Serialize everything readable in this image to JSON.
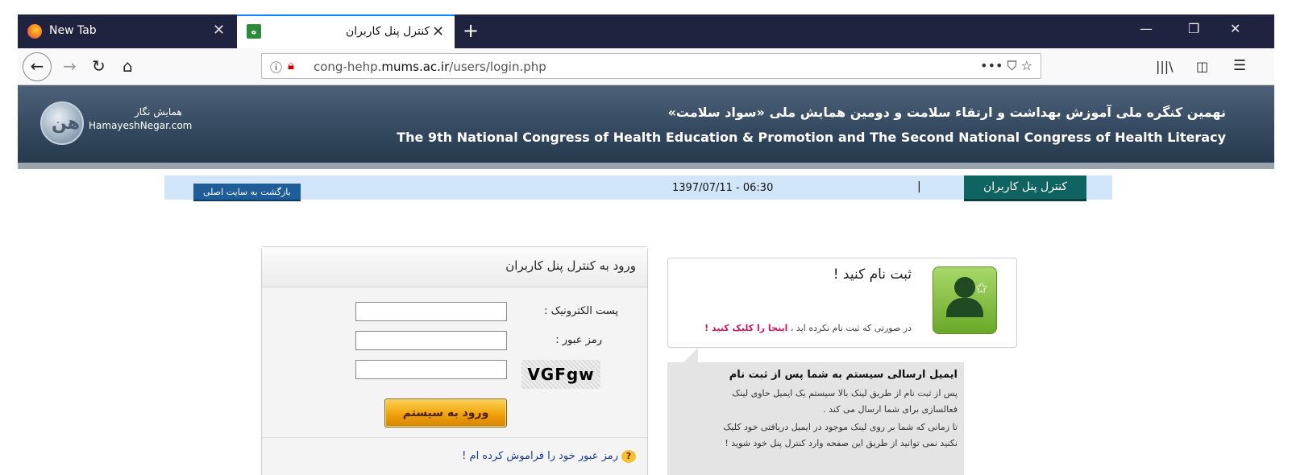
{
  "browser": {
    "tabs": [
      {
        "title": "New Tab"
      },
      {
        "title": "کنترل پنل کاربران"
      }
    ],
    "new_tab": "+",
    "url": {
      "prefix": "cong-hehp.",
      "domain": "mums.ac.ir",
      "path": "/users/login.php"
    },
    "url_actions": "•••  ⛉  ☆",
    "toolbar_right": [
      "|||\\",
      "◫",
      "☰"
    ]
  },
  "site": {
    "logo_fa": "همایش نگار",
    "logo_en": "HamayeshNegar.com",
    "header_fa": "نهمین کنگره ملی آموزش بهداشت و ارتقاء سلامت و دومین همایش ملی «سواد سلامت»",
    "header_en": "The 9th National Congress of Health Education & Promotion and The Second National Congress of Health Literacy"
  },
  "infobar": {
    "back_to_site": "بازگشت به سایت اصلی",
    "datetime": "1397/07/11 - 06:30",
    "separator": "|",
    "panel_tab": "کنترل پنل کاربران"
  },
  "login": {
    "title": "ورود به کنترل پنل کاربران",
    "email_label": "پست الکترونیک :",
    "password_label": "رمز عبور :",
    "captcha": "VGFgw",
    "submit": "ورود به سیستم",
    "forgot": "رمز عبور خود را فراموش کرده ام !"
  },
  "register": {
    "title": "ثبت نام کنید !",
    "text": "در صورتی که ثبت نام نکرده اید ، ",
    "link": "اینجا را کلیک کنید !"
  },
  "email_info": {
    "title": "ایمیل ارسالی سیستم به شما پس از ثبت نام",
    "lines": [
      "پس از ثبت نام از طریق لینک بالا سیستم یک ایمیل حاوی لینک",
      "فعالسازی برای شما ارسال می کند .",
      "تا زمانی که شما بر روی لینک موجود در ایمیل دریافتی خود کلیک",
      "نکنید نمی توانید از طریق این صفحه وارد کنترل پنل خود شوید !"
    ]
  }
}
